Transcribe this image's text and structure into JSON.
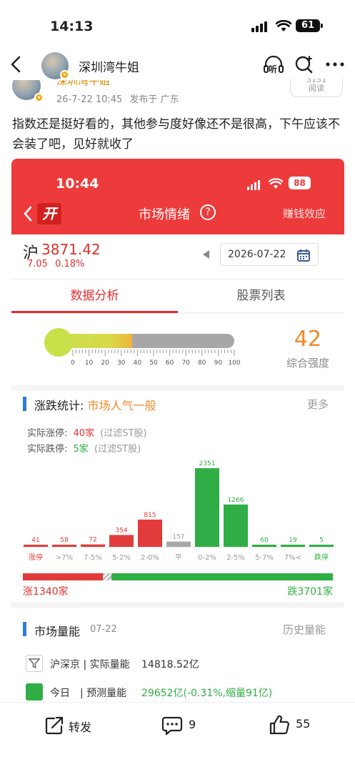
{
  "status_bar": {
    "time": "14:13",
    "battery": "61"
  },
  "nav": {
    "back_icon": "chevron-left-icon",
    "name": "深圳湾牛姐",
    "listen_icon": "headphone-listen-icon",
    "listen_label": "听",
    "search_icon": "search-plus-icon",
    "more_icon": "more-dots-icon"
  },
  "post": {
    "author_partial": "深圳湾牛姐",
    "time": "26-7-22 10:45",
    "location": "发布于 广东",
    "read_count_partial": "3151",
    "read_label": "阅读",
    "text": "指数还是挺好看的，其他参与度好像还不是很高，下午应该不会装了吧，见好就收了"
  },
  "screenshot": {
    "status_time": "10:44",
    "battery": "88",
    "header": {
      "logo": "开",
      "title": "市场情绪",
      "help_icon": "question-circle-icon",
      "right_link": "赚钱效应"
    },
    "index": {
      "name": "沪",
      "value": "3871.42",
      "change": "7.05",
      "pct": "0.18%"
    },
    "date": {
      "value": "2026-07-22",
      "calendar_icon": "calendar-icon"
    },
    "tabs": [
      {
        "label": "数据分析",
        "active": true
      },
      {
        "label": "股票列表",
        "active": false
      }
    ],
    "gauge": {
      "value": 42,
      "label": "综合强度",
      "ticks": [
        "0",
        "10",
        "20",
        "30",
        "40",
        "50",
        "60",
        "70",
        "80",
        "90",
        "100"
      ]
    },
    "updown": {
      "title": "涨跌统计:",
      "mood": "市场人气一般",
      "more": "更多",
      "limit_up_label": "实际涨停:",
      "limit_up_value": "40家",
      "limit_up_note": "(过滤ST股)",
      "limit_down_label": "实际跌停:",
      "limit_down_value": "5家",
      "limit_down_note": "(过滤ST股)",
      "up_total": "涨1340家",
      "down_total": "跌3701家",
      "up_share": 0.2658
    },
    "volume": {
      "title": "市场量能",
      "date": "07-22",
      "history": "历史量能",
      "row1_label": "沪深京 | 实际量能",
      "row1_value": "14818.52亿",
      "row2_label": "今日",
      "row2_sub": "| 预测量能",
      "row2_value": "29652亿(-0.31%,缩量91亿)"
    }
  },
  "chart_data": {
    "type": "bar",
    "categories": [
      "涨停",
      ">7%",
      "7-5%",
      "5-2%",
      "2-0%",
      "平",
      "0-2%",
      "2-5%",
      "5-7%",
      "7%<",
      "跌停"
    ],
    "values": [
      41,
      58,
      72,
      354,
      815,
      157,
      2351,
      1266,
      60,
      19,
      5
    ],
    "colors": [
      "#e23b3b",
      "#e23b3b",
      "#e23b3b",
      "#e23b3b",
      "#e23b3b",
      "#a8a8a8",
      "#2fae45",
      "#2fae45",
      "#2fae45",
      "#2fae45",
      "#2fae45"
    ]
  },
  "bottom_bar": {
    "share_label": "转发",
    "share_icon": "share-icon",
    "comment_count": "9",
    "comment_icon": "comment-icon",
    "like_count": "55",
    "like_icon": "thumbs-up-icon"
  }
}
